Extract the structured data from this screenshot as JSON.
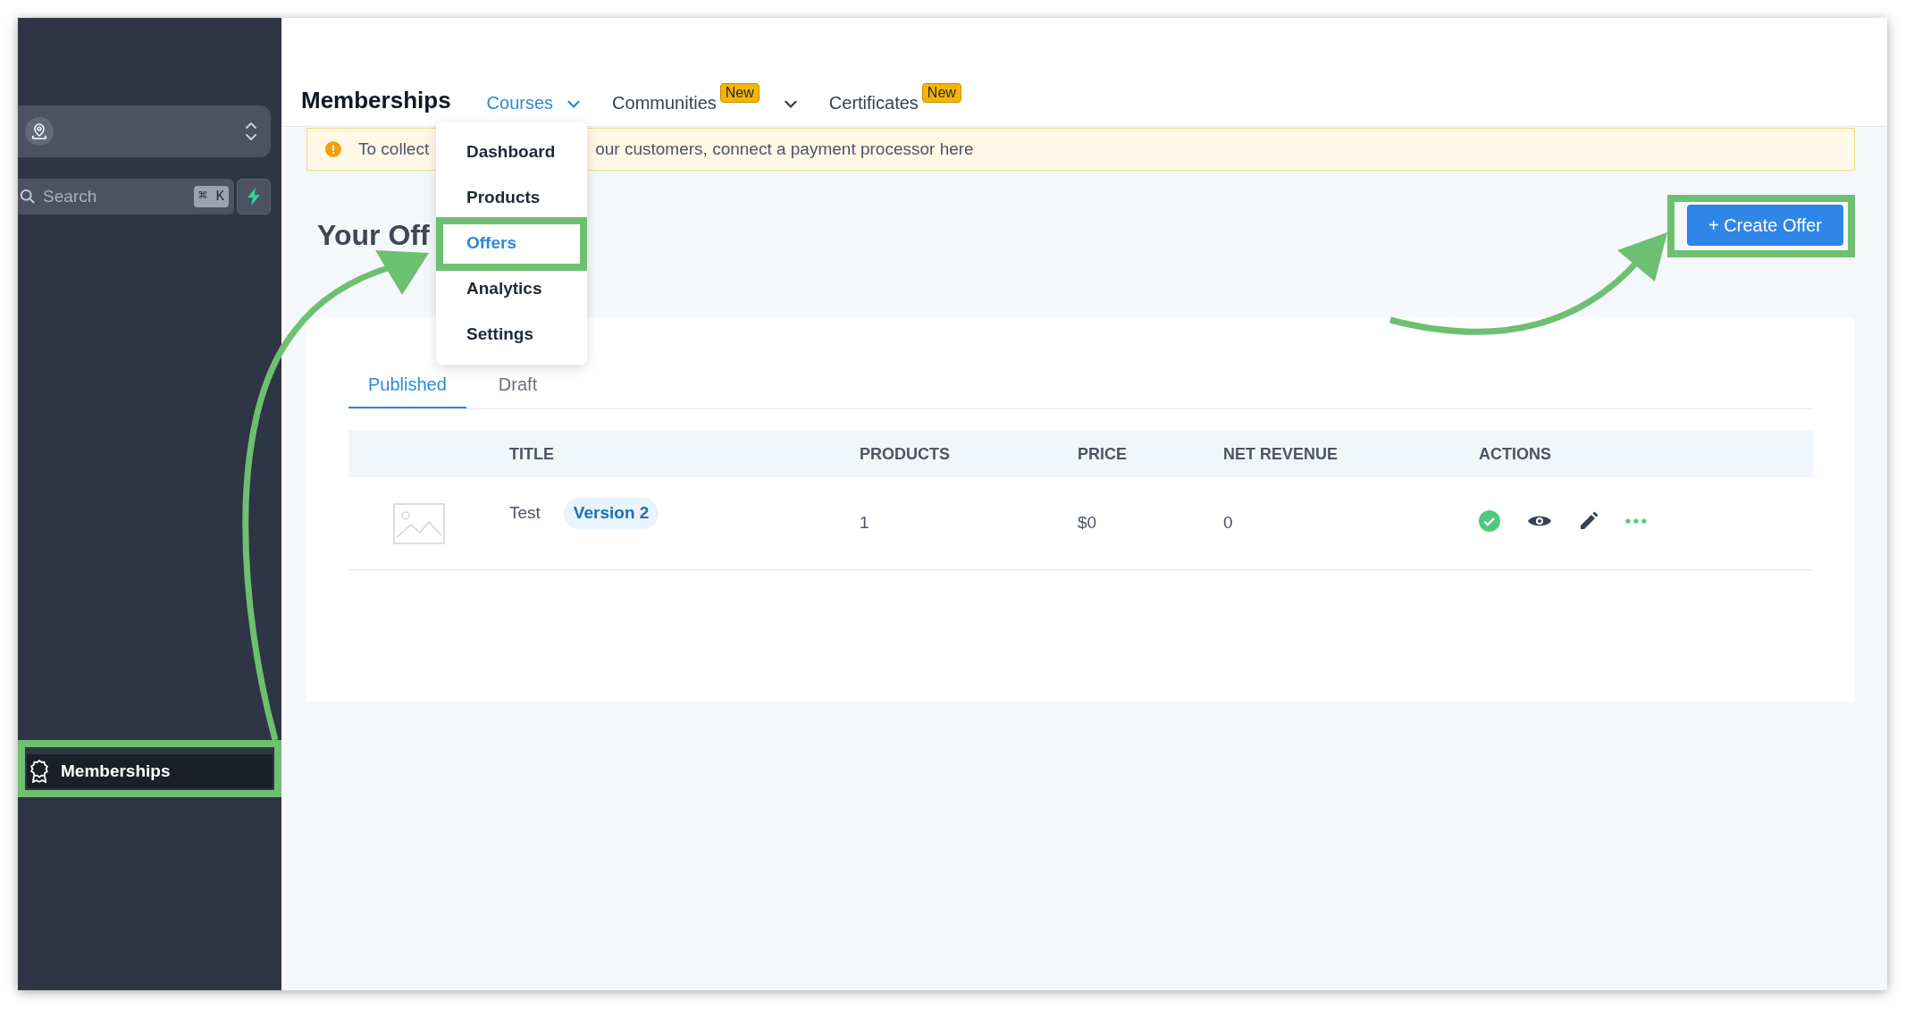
{
  "sidebar": {
    "search": {
      "placeholder": "Search",
      "shortcut": "⌘ K"
    },
    "items": [
      {
        "label": "Memberships",
        "selected": true
      }
    ]
  },
  "header": {
    "title": "Memberships",
    "nav": [
      {
        "label": "Courses",
        "selected": true,
        "menu": true
      },
      {
        "label": "Communities",
        "selected": false,
        "badge": "New",
        "menu": true
      },
      {
        "label": "Certificates",
        "selected": false,
        "badge": "New",
        "menu": false
      }
    ]
  },
  "courses_menu": [
    {
      "label": "Dashboard",
      "selected": false
    },
    {
      "label": "Products",
      "selected": false
    },
    {
      "label": "Offers",
      "selected": true
    },
    {
      "label": "Analytics",
      "selected": false
    },
    {
      "label": "Settings",
      "selected": false
    }
  ],
  "banner": {
    "text_before": "To collect",
    "text_after": "our customers, connect a payment processor here"
  },
  "heading": "Your Off",
  "create_button": "+ Create Offer",
  "tabs": [
    {
      "label": "Published",
      "selected": true
    },
    {
      "label": "Draft",
      "selected": false
    }
  ],
  "table": {
    "columns": [
      "",
      "TITLE",
      "PRODUCTS",
      "PRICE",
      "NET REVENUE",
      "ACTIONS"
    ],
    "rows": [
      {
        "badge": "Version 2",
        "cells": [
          "",
          "Test",
          "1",
          "$0",
          "0"
        ]
      }
    ]
  }
}
